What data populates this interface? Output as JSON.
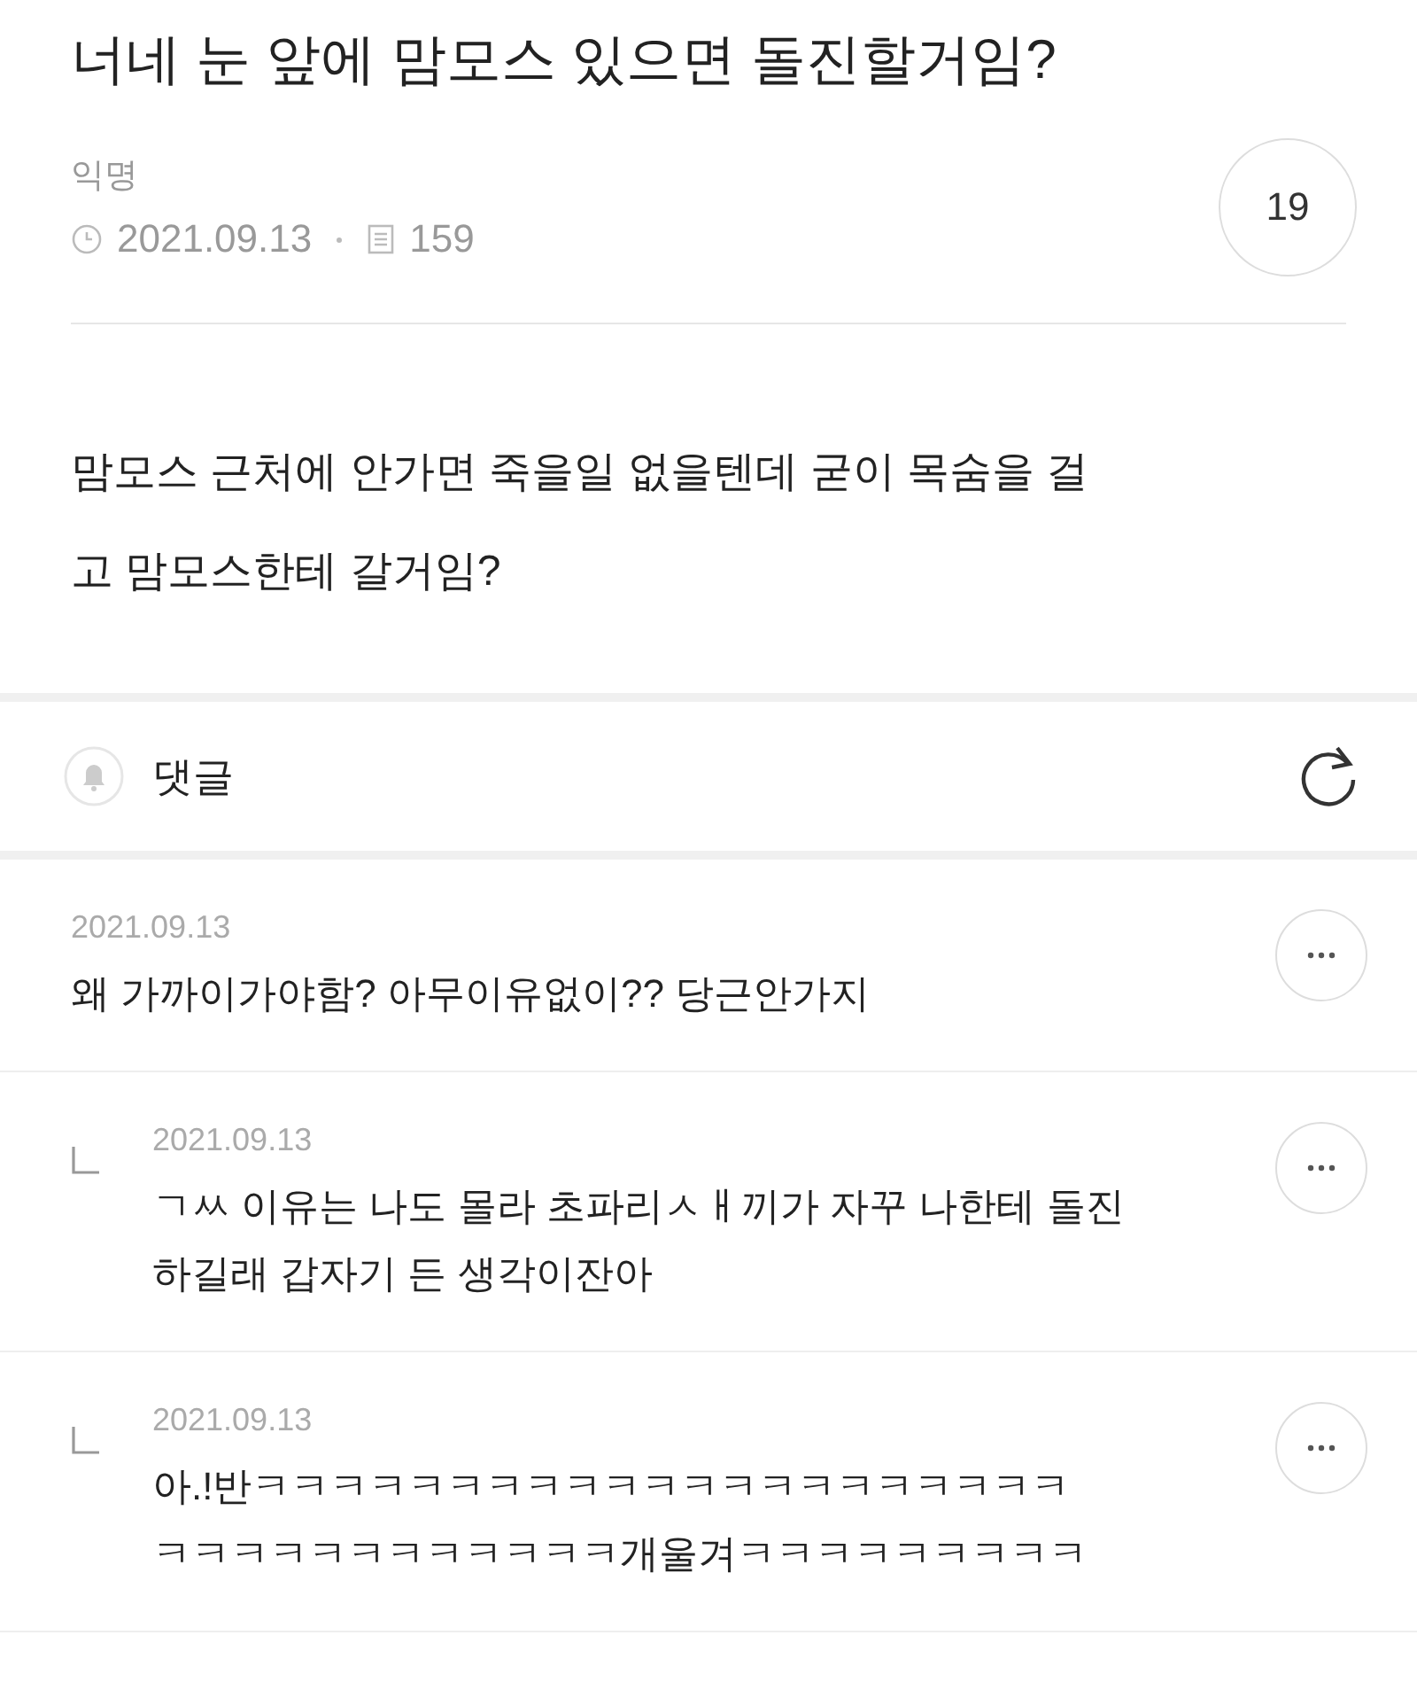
{
  "post": {
    "title": "너네 눈 앞에 맘모스 있으면 돌진할거임?",
    "author": "익명",
    "date": "2021.09.13",
    "views": "159",
    "comment_count": "19",
    "body_lines": [
      "맘모스 근처에 안가면 죽을일 없을텐데 굳이 목숨을 걸",
      "고 맘모스한테 갈거임?"
    ]
  },
  "comments_header": {
    "label": "댓글"
  },
  "comments": [
    {
      "kind": "comment",
      "date": "2021.09.13",
      "lines": [
        "왜 가까이가야함? 아무이유없이?? 당근안가지"
      ]
    },
    {
      "kind": "reply",
      "date": "2021.09.13",
      "lines": [
        "ㄱㅆ 이유는 나도 몰라 초파리ㅅㅐ끼가 자꾸 나한테 돌진",
        "하길래 갑자기 든 생각이잔아"
      ]
    },
    {
      "kind": "reply",
      "date": "2021.09.13",
      "lines": [
        "아.!반ㅋㅋㅋㅋㅋㅋㅋㅋㅋㅋㅋㅋㅋㅋㅋㅋㅋㅋㅋㅋㅋ",
        "ㅋㅋㅋㅋㅋㅋㅋㅋㅋㅋㅋㅋ개울겨ㅋㅋㅋㅋㅋㅋㅋㅋㅋ"
      ]
    }
  ]
}
